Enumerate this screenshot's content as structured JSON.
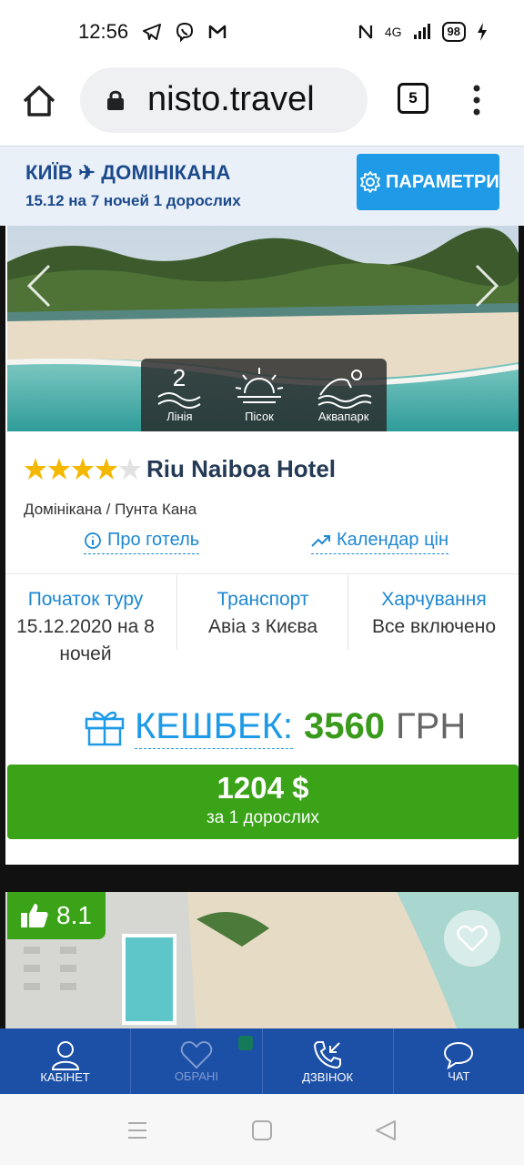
{
  "status_bar": {
    "time": "12:56",
    "network": "4G",
    "battery": "98"
  },
  "browser": {
    "url": "nisto.travel",
    "tab_count": "5"
  },
  "search": {
    "route": "КИЇВ ✈ ДОМІНІКАНА",
    "dates": "15.12 на 7 ночей 1 дорослих",
    "params_button": "ПАРАМЕТРИ"
  },
  "hotel": {
    "features": [
      {
        "icon": "line-2-icon",
        "label": "Лінія"
      },
      {
        "icon": "sand-sunset-icon",
        "label": "Пісок"
      },
      {
        "icon": "aquapark-icon",
        "label": "Аквапарк"
      }
    ],
    "stars": 4,
    "name": "Riu Naiboa Hotel",
    "location": "Домінікана / Пунта Кана",
    "about_link": "Про готель",
    "calendar_link": "Календар цін",
    "info": {
      "start_label": "Початок туру",
      "start_value": "15.12.2020 на 8",
      "start_value_2": "ночей",
      "transport_label": "Транспорт",
      "transport_value": "Авіа з Києва",
      "meals_label": "Харчування",
      "meals_value": "Все включено"
    },
    "cashback": {
      "label": "КЕШБЕК",
      "colon": ":",
      "amount": "3560",
      "currency": "ГРН"
    },
    "price": "1204 $",
    "price_sub": "за 1 дорослих"
  },
  "next_hotel": {
    "rating": "8.1"
  },
  "bottom_nav": {
    "cabinet": "КАБІНЕТ",
    "favorites": "ОБРАНІ",
    "call": "ДЗВІНОК",
    "chat": "ЧАТ"
  },
  "colors": {
    "accent": "#1e9ae6",
    "green": "#3aa317",
    "nav": "#1c4fa6",
    "title": "#1b4a8c"
  }
}
